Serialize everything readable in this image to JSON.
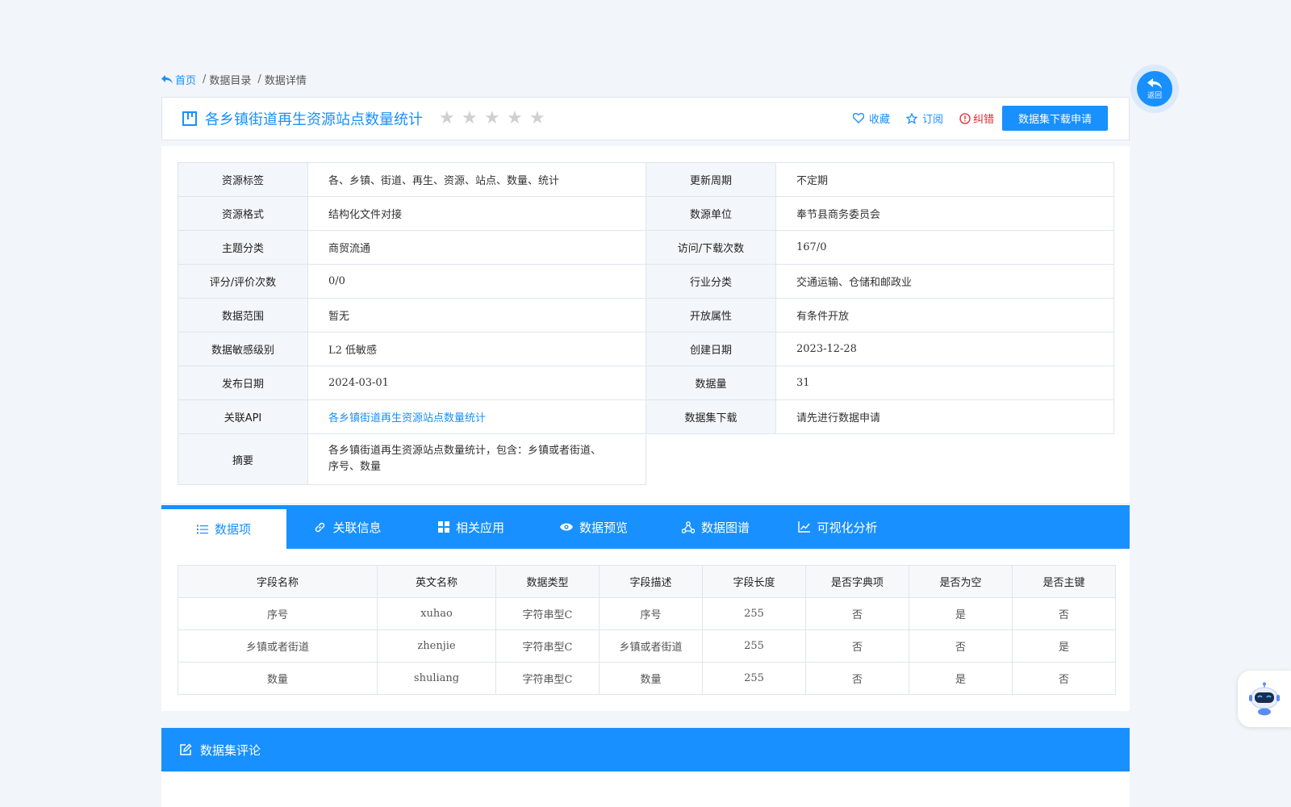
{
  "breadcrumb": {
    "home": "首页",
    "items": [
      "数据目录",
      "数据详情"
    ]
  },
  "title": {
    "text": "各乡镇街道再生资源站点数量统计",
    "rating": 0,
    "rating_max": 5,
    "actions": {
      "favorite": "收藏",
      "subscribe": "订阅",
      "report": "纠错",
      "download_apply": "数据集下载申请"
    }
  },
  "info": {
    "rows": [
      [
        {
          "label": "资源标签",
          "value": "各、乡镇、街道、再生、资源、站点、数量、统计"
        },
        {
          "label": "更新周期",
          "value": "不定期"
        }
      ],
      [
        {
          "label": "资源格式",
          "value": "结构化文件对接"
        },
        {
          "label": "数源单位",
          "value": "奉节县商务委员会"
        }
      ],
      [
        {
          "label": "主题分类",
          "value": "商贸流通"
        },
        {
          "label": "访问/下载次数",
          "value": "167/0"
        }
      ],
      [
        {
          "label": "评分/评价次数",
          "value": "0/0"
        },
        {
          "label": "行业分类",
          "value": "交通运输、仓储和邮政业"
        }
      ],
      [
        {
          "label": "数据范围",
          "value": "暂无"
        },
        {
          "label": "开放属性",
          "value": "有条件开放"
        }
      ],
      [
        {
          "label": "数据敏感级别",
          "value": "L2 低敏感"
        },
        {
          "label": "创建日期",
          "value": "2023-12-28"
        }
      ],
      [
        {
          "label": "发布日期",
          "value": "2024-03-01"
        },
        {
          "label": "数据量",
          "value": "31"
        }
      ],
      [
        {
          "label": "关联API",
          "value": "各乡镇街道再生资源站点数量统计"
        },
        {
          "label": "数据集下载",
          "value": "请先进行数据申请"
        }
      ]
    ],
    "summary": {
      "label": "摘要",
      "value_line1": "各乡镇街道再生资源站点数量统计，包含：乡镇或者街道、",
      "value_line2": "序号、数量"
    }
  },
  "tabs": [
    "数据项",
    "关联信息",
    "相关应用",
    "数据预览",
    "数据图谱",
    "可视化分析"
  ],
  "fields_table": {
    "headers": [
      "字段名称",
      "英文名称",
      "数据类型",
      "字段描述",
      "字段长度",
      "是否字典项",
      "是否为空",
      "是否主键"
    ],
    "rows": [
      [
        "序号",
        "xuhao",
        "字符串型C",
        "序号",
        "255",
        "否",
        "是",
        "否"
      ],
      [
        "乡镇或者街道",
        "zhenjie",
        "字符串型C",
        "乡镇或者街道",
        "255",
        "否",
        "否",
        "是"
      ],
      [
        "数量",
        "shuliang",
        "字符串型C",
        "数量",
        "255",
        "否",
        "是",
        "否"
      ]
    ]
  },
  "comments": {
    "title": "数据集评论"
  },
  "back_button": {
    "label": "返回"
  },
  "colors": {
    "primary": "#1890ff",
    "danger": "#e2262c",
    "label_bg": "#f3f6fa",
    "page_bg": "#f2f5f9"
  }
}
